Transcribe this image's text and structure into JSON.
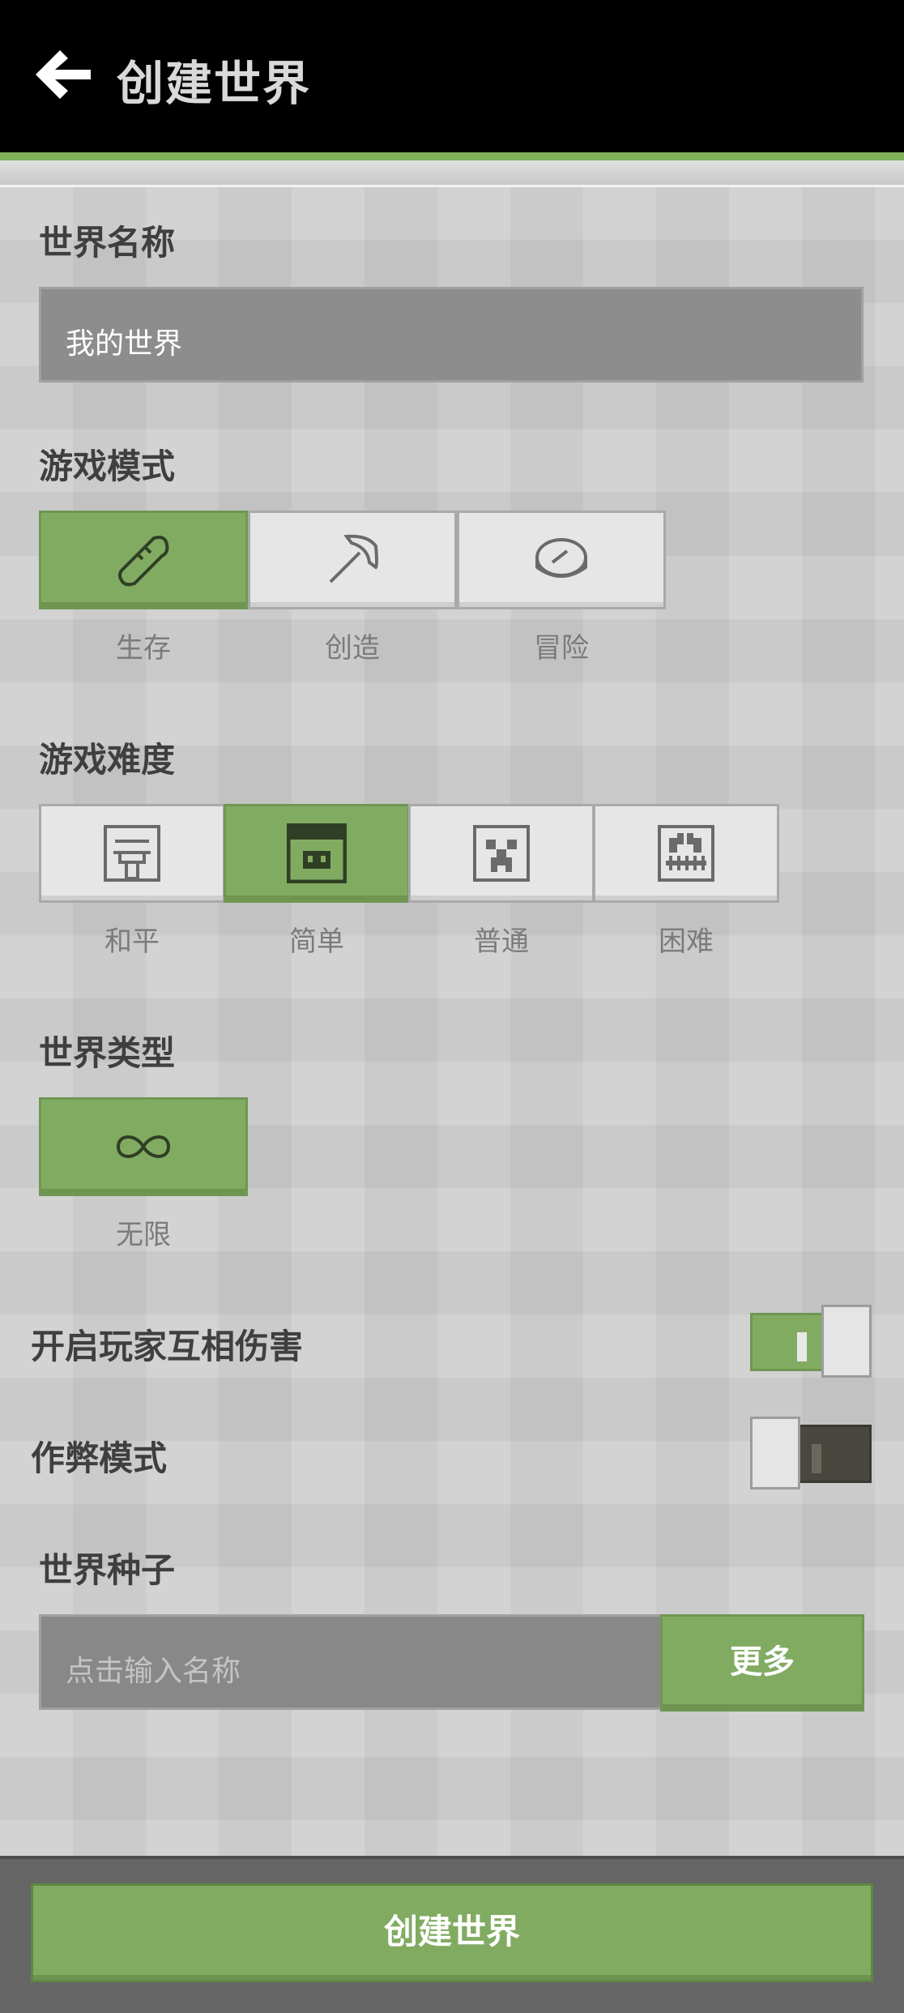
{
  "header": {
    "title": "创建世界"
  },
  "world_name": {
    "label": "世界名称",
    "value": "我的世界"
  },
  "game_mode": {
    "label": "游戏模式",
    "options": [
      {
        "label": "生存",
        "icon": "bread-icon",
        "selected": true
      },
      {
        "label": "创造",
        "icon": "pickaxe-icon",
        "selected": false
      },
      {
        "label": "冒险",
        "icon": "compass-icon",
        "selected": false
      }
    ]
  },
  "difficulty": {
    "label": "游戏难度",
    "options": [
      {
        "label": "和平",
        "icon": "villager-icon",
        "selected": false
      },
      {
        "label": "简单",
        "icon": "pig-icon",
        "selected": true
      },
      {
        "label": "普通",
        "icon": "creeper-icon",
        "selected": false
      },
      {
        "label": "困难",
        "icon": "ghast-icon",
        "selected": false
      }
    ]
  },
  "world_type": {
    "label": "世界类型",
    "options": [
      {
        "label": "无限",
        "icon": "infinity-icon",
        "selected": true
      }
    ]
  },
  "toggles": [
    {
      "label": "开启玩家互相伤害",
      "on": true
    },
    {
      "label": "作弊模式",
      "on": false
    }
  ],
  "seed": {
    "label": "世界种子",
    "placeholder": "点击输入名称",
    "more_label": "更多"
  },
  "footer": {
    "create_label": "创建世界"
  },
  "colors": {
    "accent_green": "#82ab62",
    "dark_toggle": "#4a4740"
  }
}
